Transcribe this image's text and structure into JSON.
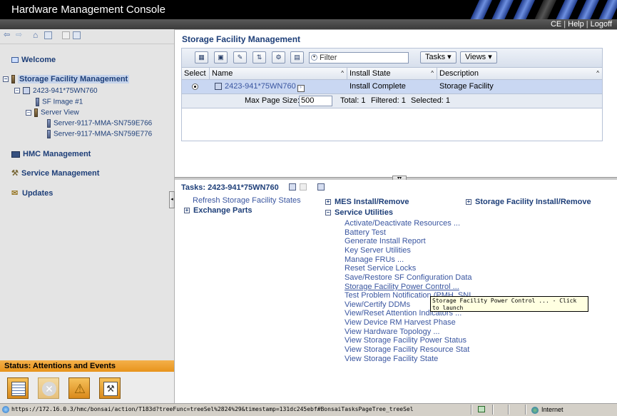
{
  "app": {
    "title": "Hardware Management Console",
    "links": [
      "CE",
      "Help",
      "Logoff"
    ]
  },
  "nav": {
    "welcome": "Welcome",
    "storage": "Storage Facility Management",
    "facility": "2423-941*75WN760",
    "sf_image": "SF Image #1",
    "server_view": "Server View",
    "servers": [
      "Server-9117-MMA-SN759E766",
      "Server-9117-MMA-SN759E776"
    ],
    "hmc": "HMC Management",
    "service": "Service Management",
    "updates": "Updates"
  },
  "status": {
    "header": "Status: Attentions and Events",
    "icons": [
      "event-list-icon",
      "error-icon",
      "warning-icon",
      "service-icon"
    ]
  },
  "sfm": {
    "title": "Storage Facility Management",
    "filter_placeholder": "Filter",
    "tasks_btn": "Tasks",
    "views_btn": "Views",
    "columns": [
      "Select",
      "Name",
      "Install State",
      "Description"
    ],
    "row": {
      "name": "2423-941*75WN760",
      "install_state": "Install Complete",
      "description": "Storage Facility"
    },
    "footer": {
      "max_page_label": "Max Page Size:",
      "max_page_value": "500",
      "total": "Total: 1",
      "filtered": "Filtered: 1",
      "selected": "Selected: 1"
    }
  },
  "tasks": {
    "title": "Tasks: 2423-941*75WN760",
    "refresh": "Refresh Storage Facility States",
    "exchange": "Exchange Parts",
    "mes": "MES Install/Remove",
    "sf_install": "Storage Facility Install/Remove",
    "service_utilities": "Service Utilities",
    "items": [
      "Activate/Deactivate Resources ...",
      "Battery Test",
      "Generate Install Report",
      "Key Server Utilities",
      "Manage FRUs ...",
      "Reset Service Locks",
      "Save/Restore SF Configuration Data",
      "Storage Facility Power Control ...",
      "Test Problem Notification (PMH, SNI",
      "View/Certify DDMs",
      "View/Reset Attention Indicators ...",
      "View Device RM Harvest Phase",
      "View Hardware Topology ...",
      "View Storage Facility Power Status",
      "View Storage Facility Resource Stat",
      "View Storage Facility State"
    ],
    "tooltip": "Storage Facility Power Control ... - Click to launch"
  },
  "browser": {
    "url": "https://172.16.0.3/hmc/bonsai/action/T183d?treeFunc=treeSel%2824%29&timestamp=131dc245ebf#BonsaiTasksPageTree_treeSel",
    "zone": "Internet"
  },
  "colors": {
    "nav_text": "#1d3e78",
    "task_link": "#3a56a0",
    "status_orange": "#e8941c",
    "selected_row": "#c9d7f2"
  }
}
